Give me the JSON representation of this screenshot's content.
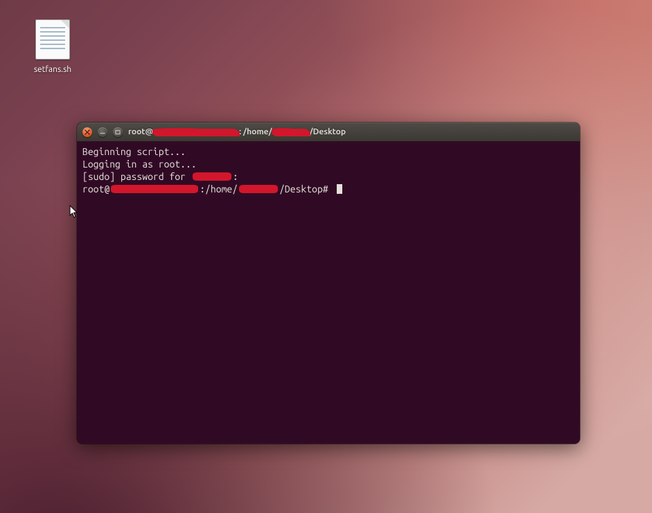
{
  "desktop": {
    "file_label": "setfans.sh"
  },
  "window": {
    "title": {
      "prefix": "root@",
      "mid": ": /home/",
      "suffix": "/Desktop"
    }
  },
  "terminal": {
    "line1": "Beginning script...",
    "line2": "Logging in as root...",
    "line3_prefix": "[sudo] password for ",
    "line3_suffix": ":",
    "line4_prefix": "root@",
    "line4_mid": ":/home/",
    "line4_suffix": "/Desktop# "
  },
  "colors": {
    "terminal_bg": "#300a24",
    "redaction": "#d2162c",
    "close_btn": "#d9501e"
  }
}
